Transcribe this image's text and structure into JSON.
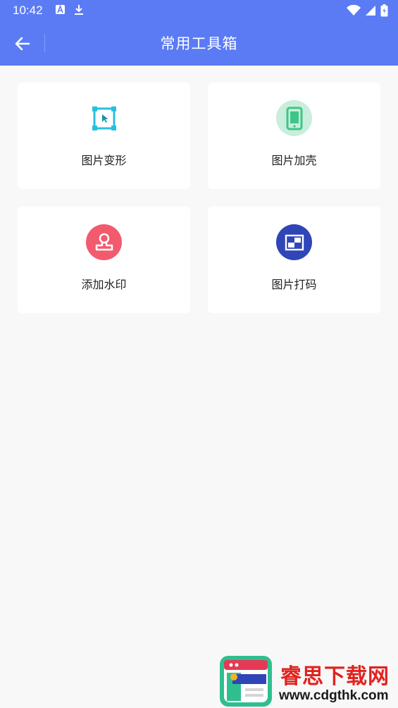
{
  "status_bar": {
    "time": "10:42"
  },
  "app_bar": {
    "title": "常用工具箱"
  },
  "tools": [
    {
      "label": "图片变形",
      "icon": "transform-icon",
      "color": "#27c0de"
    },
    {
      "label": "图片加壳",
      "icon": "phone-shell-icon",
      "color": "#3fc58a"
    },
    {
      "label": "添加水印",
      "icon": "stamp-icon",
      "color": "#f25a6e"
    },
    {
      "label": "图片打码",
      "icon": "mosaic-icon",
      "color": "#2f45b8"
    }
  ],
  "watermark": {
    "title": "睿思下载网",
    "url": "www.cdgthk.com"
  },
  "colors": {
    "primary": "#5b7bf5",
    "background": "#f8f8f8"
  }
}
